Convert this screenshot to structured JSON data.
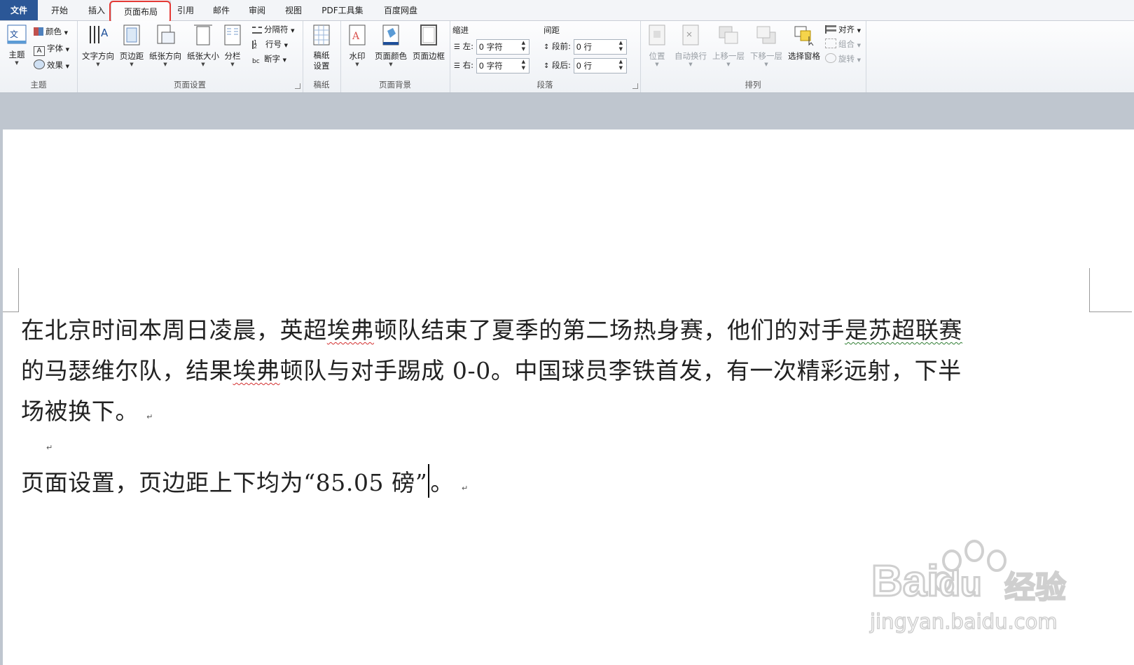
{
  "tabs": [
    {
      "label": "文件"
    },
    {
      "label": "开始"
    },
    {
      "label": "插入"
    },
    {
      "label": "页面布局"
    },
    {
      "label": "引用"
    },
    {
      "label": "邮件"
    },
    {
      "label": "审阅"
    },
    {
      "label": "视图"
    },
    {
      "label": "PDF工具集"
    },
    {
      "label": "百度网盘"
    }
  ],
  "ribbon": {
    "theme": {
      "group_label": "主题",
      "theme_btn": "主题",
      "colors": "颜色",
      "fonts": "字体",
      "effects": "效果"
    },
    "page_setup": {
      "group_label": "页面设置",
      "text_direction": "文字方向",
      "margins": "页边距",
      "orientation": "纸张方向",
      "size": "纸张大小",
      "columns": "分栏",
      "breaks": "分隔符",
      "line_numbers": "行号",
      "hyphenation": "断字"
    },
    "manuscript": {
      "group_label": "稿纸",
      "btn_line1": "稿纸",
      "btn_line2": "设置"
    },
    "page_background": {
      "group_label": "页面背景",
      "watermark": "水印",
      "page_color": "页面颜色",
      "page_borders": "页面边框"
    },
    "paragraph": {
      "group_label": "段落",
      "indent_title": "缩进",
      "spacing_title": "间距",
      "left_label": "左:",
      "right_label": "右:",
      "left_value": "0 字符",
      "right_value": "0 字符",
      "before_label": "段前:",
      "after_label": "段后:",
      "before_value": "0 行",
      "after_value": "0 行"
    },
    "arrange": {
      "group_label": "排列",
      "position": "位置",
      "wrap_text": "自动换行",
      "bring_forward": "上移一层",
      "send_backward": "下移一层",
      "selection_pane": "选择窗格",
      "align": "对齐",
      "group": "组合",
      "rotate": "旋转"
    }
  },
  "document": {
    "para1_a": "在北京时间本周日凌晨，英超",
    "para1_b": "埃弗",
    "para1_c": "顿队结束了夏季的第二场热身赛，他们的对手",
    "para1_d": "是苏超联赛",
    "para1_line2_a": "的马瑟维尔队，结果",
    "para1_line2_b": "埃弗",
    "para1_line2_c": "顿队与对手踢成 0-0。中国球员李铁首发，有一次精彩远射，下半",
    "para1_line3": "场被换下。",
    "para2": "页面设置，页边距上下均为“85.05 磅”",
    "para2_end": "。",
    "para_mark": "↵"
  },
  "watermark": {
    "brand": "Bai",
    "brand2": "du",
    "cn": "经验",
    "url": "jingyan.baidu.com"
  }
}
